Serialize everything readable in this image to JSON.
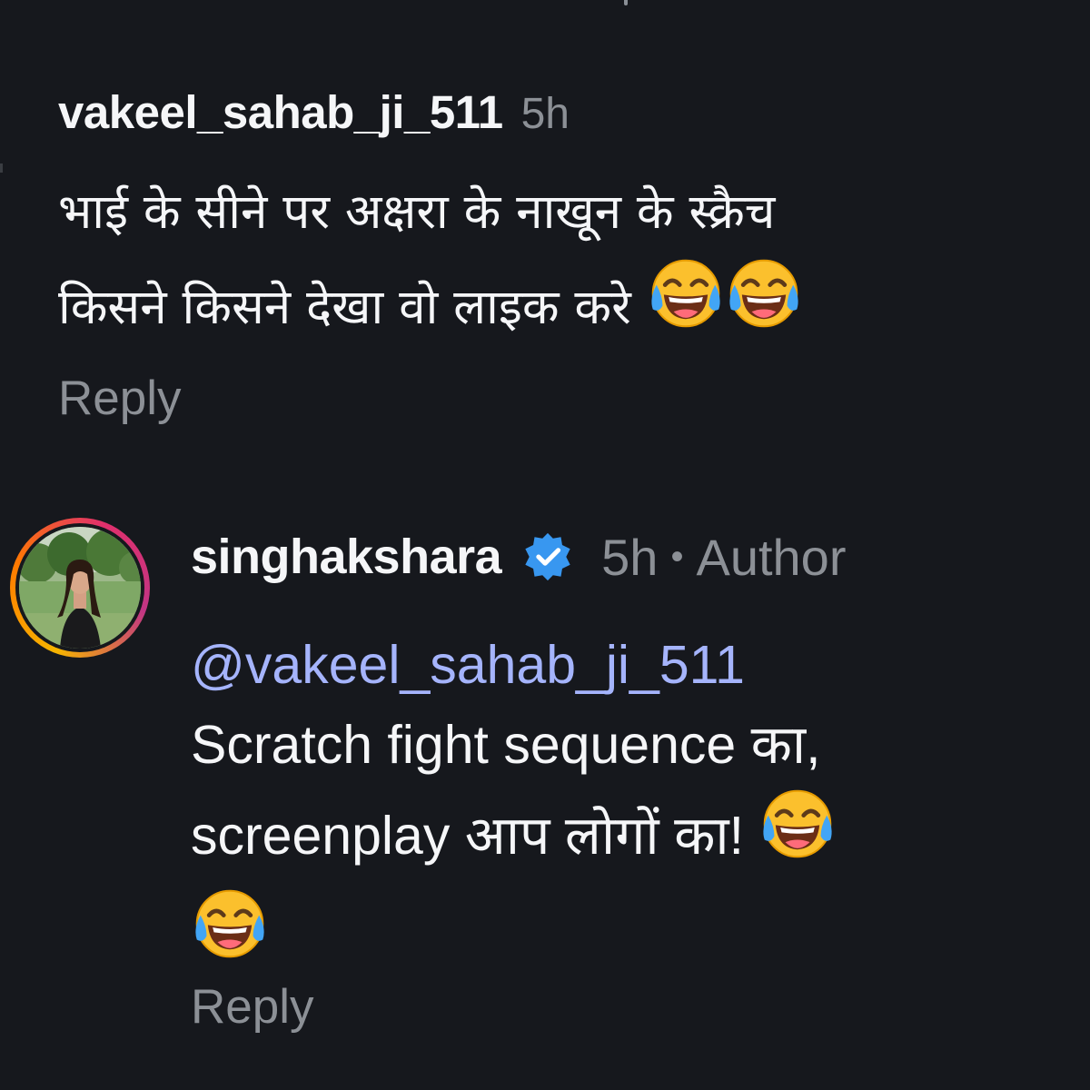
{
  "comment_1": {
    "username": "vakeel_sahab_ji_511",
    "time": "5h",
    "text_line_1": "भाई के सीने पर अक्षरा के नाखून के स्क्रैच",
    "text_line_2": "किसने किसने देखा वो लाइक करे",
    "emojis": [
      "face-with-tears-of-joy-icon",
      "face-with-tears-of-joy-icon"
    ],
    "reply_label": "Reply"
  },
  "comment_2": {
    "username": "singhakshara",
    "verified": true,
    "time": "5h",
    "separator": "•",
    "author_label": "Author",
    "mention": "@vakeel_sahab_ji_511",
    "text_line_1": "Scratch fight sequence का,",
    "text_line_2": "screenplay आप लोगों का!",
    "emojis": [
      "face-with-tears-of-joy-icon",
      "face-with-tears-of-joy-icon"
    ],
    "reply_label": "Reply"
  },
  "colors": {
    "background": "#16181d",
    "text_primary": "#f5f6f8",
    "text_secondary": "#8c9096",
    "mention": "#a5b4fc",
    "verified_badge": "#3897f0"
  }
}
